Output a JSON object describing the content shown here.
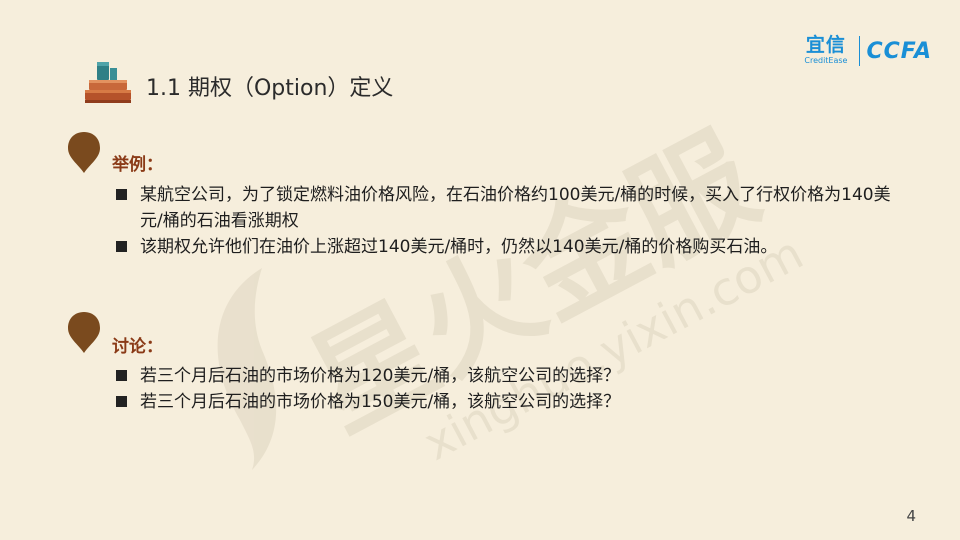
{
  "logo": {
    "cn": "宜信",
    "en": "CreditEase",
    "ccfa": "CCFA"
  },
  "watermark": {
    "cn": "星火金服",
    "en": "xinghuo.yixin.com"
  },
  "title": "1.1 期权（Option）定义",
  "sections": [
    {
      "heading": "举例：",
      "bullets": [
        "某航空公司，为了锁定燃料油价格风险，在石油价格约100美元/桶的时候，买入了行权价格为140美元/桶的石油看涨期权",
        "该期权允许他们在油价上涨超过140美元/桶时，仍然以140美元/桶的价格购买石油。"
      ]
    },
    {
      "heading": "讨论：",
      "bullets": [
        "若三个月后石油的市场价格为120美元/桶，该航空公司的选择？",
        "若三个月后石油的市场价格为150美元/桶，该航空公司的选择？"
      ]
    }
  ],
  "page_number": "4",
  "colors": {
    "background": "#f6eedc",
    "accent": "#8a3a17",
    "logo": "#1a8fd6",
    "pin": "#7a4a1e"
  }
}
